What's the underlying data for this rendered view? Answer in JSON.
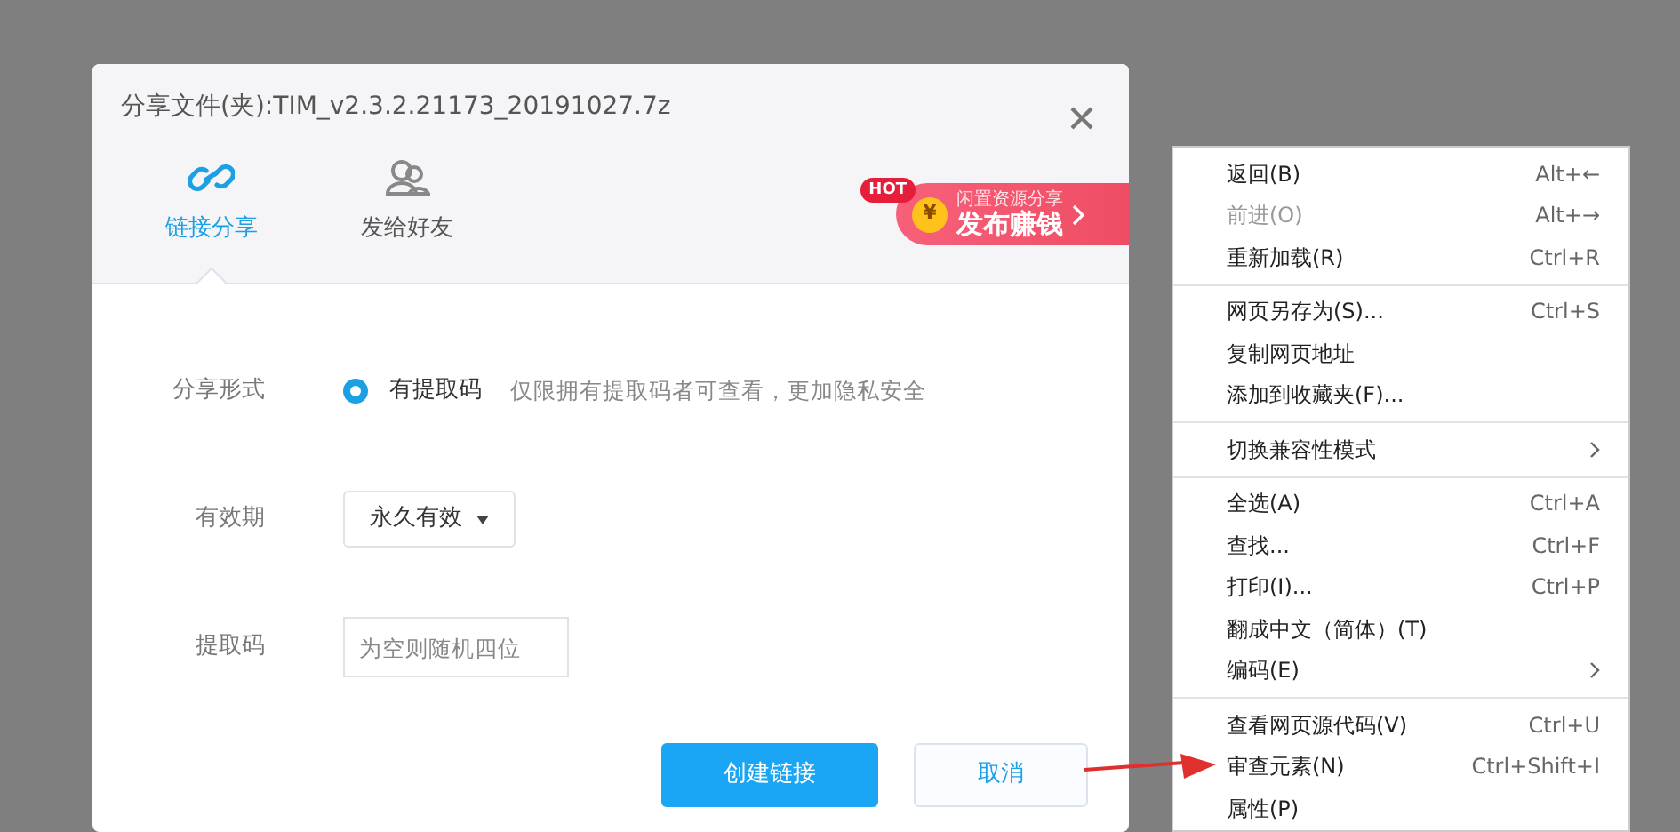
{
  "dialog": {
    "title": "分享文件(夹):TIM_v2.3.2.21173_20191027.7z",
    "tabs": [
      {
        "label": "链接分享",
        "selected": true
      },
      {
        "label": "发给好友",
        "selected": false
      }
    ],
    "promo": {
      "badge": "HOT",
      "coin": "¥",
      "line_1": "闲置资源分享",
      "line_2": "发布赚钱"
    },
    "share_type": {
      "label": "分享形式",
      "option": {
        "label": "有提取码",
        "selected": true
      },
      "hint": "仅限拥有提取码者可查看，更加隐私安全"
    },
    "validity": {
      "label": "有效期",
      "value": "永久有效"
    },
    "code": {
      "label": "提取码",
      "placeholder": "为空则随机四位"
    },
    "buttons": [
      {
        "label": "创建链接",
        "kind": "primary"
      },
      {
        "label": "取消",
        "kind": "secondary"
      }
    ]
  },
  "context_menu": {
    "groups": [
      [
        {
          "label": "返回(B)",
          "shortcut": "Alt+←",
          "disabled": false
        },
        {
          "label": "前进(O)",
          "shortcut": "Alt+→",
          "disabled": true
        },
        {
          "label": "重新加载(R)",
          "shortcut": "Ctrl+R",
          "disabled": false
        }
      ],
      [
        {
          "label": "网页另存为(S)...",
          "shortcut": "Ctrl+S",
          "disabled": false
        },
        {
          "label": "复制网页地址",
          "disabled": false
        },
        {
          "label": "添加到收藏夹(F)...",
          "disabled": false
        }
      ],
      [
        {
          "label": "切换兼容性模式",
          "submenu": true,
          "disabled": false
        }
      ],
      [
        {
          "label": "全选(A)",
          "shortcut": "Ctrl+A",
          "disabled": false
        },
        {
          "label": "查找...",
          "shortcut": "Ctrl+F",
          "disabled": false
        },
        {
          "label": "打印(I)...",
          "shortcut": "Ctrl+P",
          "disabled": false
        },
        {
          "label": "翻成中文（简体）(T)",
          "disabled": false
        },
        {
          "label": "编码(E)",
          "submenu": true,
          "disabled": false
        }
      ],
      [
        {
          "label": "查看网页源代码(V)",
          "shortcut": "Ctrl+U",
          "disabled": false
        },
        {
          "label": "审查元素(N)",
          "shortcut": "Ctrl+Shift+I",
          "disabled": false
        },
        {
          "label": "属性(P)",
          "disabled": false
        }
      ]
    ]
  }
}
